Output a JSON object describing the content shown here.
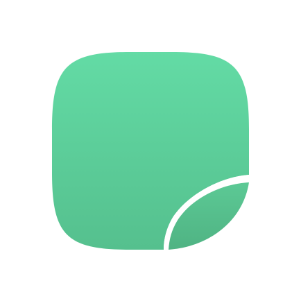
{
  "icon": {
    "name": "sticker-icon",
    "colors": {
      "top": "#63DBA5",
      "bottom": "#55C08E",
      "peel_top": "#5CC995",
      "peel_bottom": "#4FB383",
      "curl_edge": "#ffffff",
      "background": "#ffffff"
    }
  }
}
